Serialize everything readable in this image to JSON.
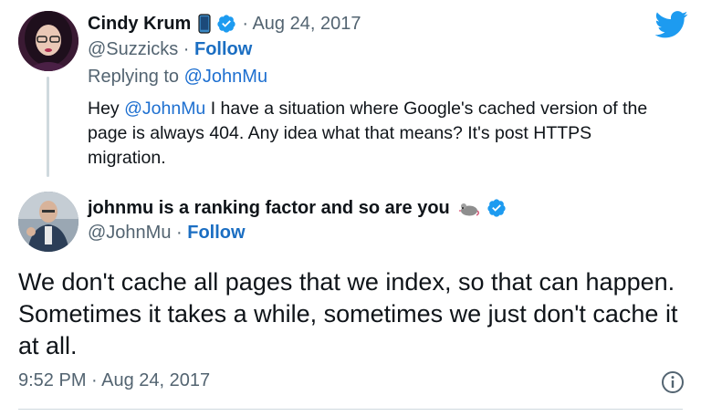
{
  "parent_tweet": {
    "author_name": "Cindy Krum",
    "date": "· Aug 24, 2017",
    "handle": "@Suzzicks",
    "separator": " · ",
    "follow_label": "Follow",
    "replying_prefix": "Replying to ",
    "replying_to": "@JohnMu",
    "text_before": "Hey ",
    "text_mention": "@JohnMu",
    "text_after": " I have a situation where Google's cached version of the page is always 404. Any idea what that means? It's post HTTPS migration."
  },
  "main_tweet": {
    "author_name": "johnmu is a ranking factor and so are you",
    "handle": "@JohnMu",
    "separator": " · ",
    "follow_label": "Follow",
    "text": "We don't cache all pages that we index, so that can happen. Sometimes it takes a while, sometimes we just don't cache it at all.",
    "timestamp": "9:52 PM · Aug 24, 2017"
  },
  "icons": {
    "logo": "twitter-bird-icon",
    "verified": "verified-badge-icon",
    "phone": "mobile-phone-icon",
    "mouse": "mouse-emoji-icon",
    "info": "info-icon"
  },
  "colors": {
    "twitter_blue": "#1d9bf0",
    "text": "#0f1419",
    "secondary_text": "#536471",
    "link": "#1b6ec2"
  }
}
